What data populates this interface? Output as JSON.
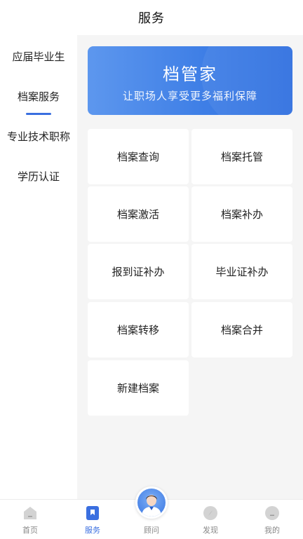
{
  "header": {
    "title": "服务"
  },
  "sidebar": {
    "items": [
      {
        "label": "应届毕业生"
      },
      {
        "label": "档案服务"
      },
      {
        "label": "专业技术职称"
      },
      {
        "label": "学历认证"
      }
    ],
    "active_index": 1
  },
  "banner": {
    "title": "档管家",
    "subtitle": "让职场人享受更多福利保障"
  },
  "services": [
    {
      "label": "档案查询"
    },
    {
      "label": "档案托管"
    },
    {
      "label": "档案激活"
    },
    {
      "label": "档案补办"
    },
    {
      "label": "报到证补办"
    },
    {
      "label": "毕业证补办"
    },
    {
      "label": "档案转移"
    },
    {
      "label": "档案合并"
    },
    {
      "label": "新建档案"
    }
  ],
  "tabbar": {
    "tabs": [
      {
        "label": "首页",
        "icon": "home-icon"
      },
      {
        "label": "服务",
        "icon": "bookmark-icon"
      },
      {
        "label": "顾问",
        "icon": "advisor-avatar"
      },
      {
        "label": "发现",
        "icon": "compass-icon"
      },
      {
        "label": "我的",
        "icon": "profile-icon"
      }
    ],
    "active_index": 1
  },
  "colors": {
    "accent": "#3a6fe0",
    "content_bg": "#f5f5f5",
    "inactive_icon": "#cfcfcf",
    "inactive_label": "#888888"
  }
}
